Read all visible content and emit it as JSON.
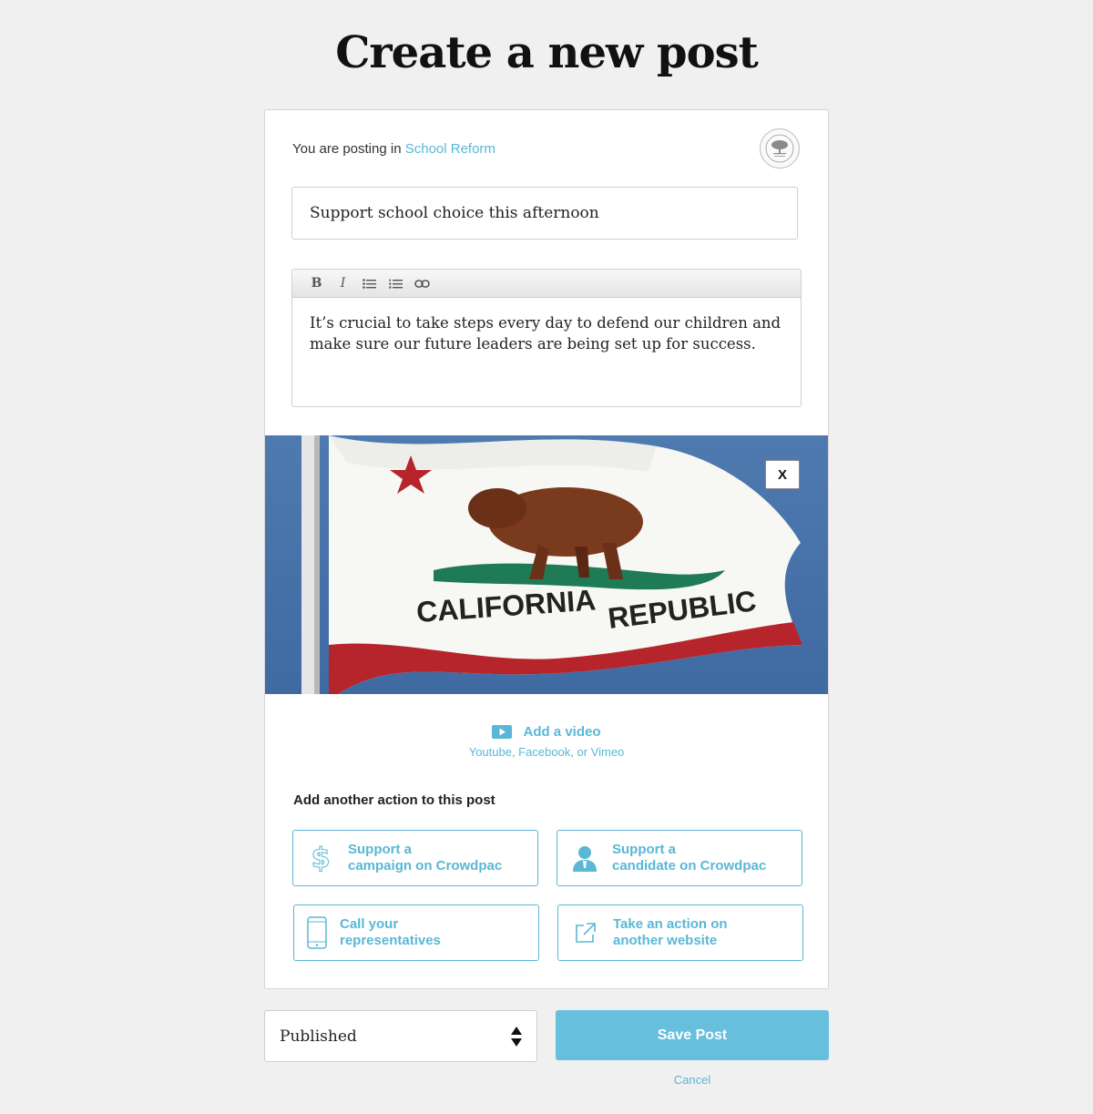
{
  "page": {
    "title": "Create a new post"
  },
  "header": {
    "posting_prefix": "You are posting in",
    "group_name": "School Reform",
    "group_avatar_icon": "city-seal-icon"
  },
  "post": {
    "title": "Support school choice this afternoon",
    "body": "It’s crucial to take steps every day to defend our children and make sure our future leaders are being set up for success."
  },
  "editor_toolbar": {
    "buttons": [
      {
        "name": "bold-icon",
        "glyph": "B"
      },
      {
        "name": "italic-icon",
        "glyph": "I"
      },
      {
        "name": "bulleted-list-icon"
      },
      {
        "name": "numbered-list-icon"
      },
      {
        "name": "link-icon"
      }
    ]
  },
  "image": {
    "remove_label": "X",
    "flag_text_left": "CALIFORNIA",
    "flag_text_right": "REPUBLIC"
  },
  "video": {
    "label": "Add a video",
    "hint": "Youtube, Facebook, or Vimeo",
    "icon": "play-icon"
  },
  "actions": {
    "heading": "Add another action to this post",
    "items": [
      {
        "line1": "Support a",
        "line2": "campaign on Crowdpac",
        "icon": "dollar-icon"
      },
      {
        "line1": "Support a",
        "line2": "candidate on Crowdpac",
        "icon": "candidate-icon"
      },
      {
        "line1": "Call your",
        "line2": "representatives",
        "icon": "phone-icon"
      },
      {
        "line1": "Take an action on",
        "line2": "another website",
        "icon": "external-link-icon"
      }
    ]
  },
  "footer": {
    "status_value": "Published",
    "save_label": "Save Post",
    "cancel_label": "Cancel"
  },
  "colors": {
    "accent": "#5ab7d6",
    "save_button": "#65bfdd",
    "background": "#f0f0f0"
  }
}
